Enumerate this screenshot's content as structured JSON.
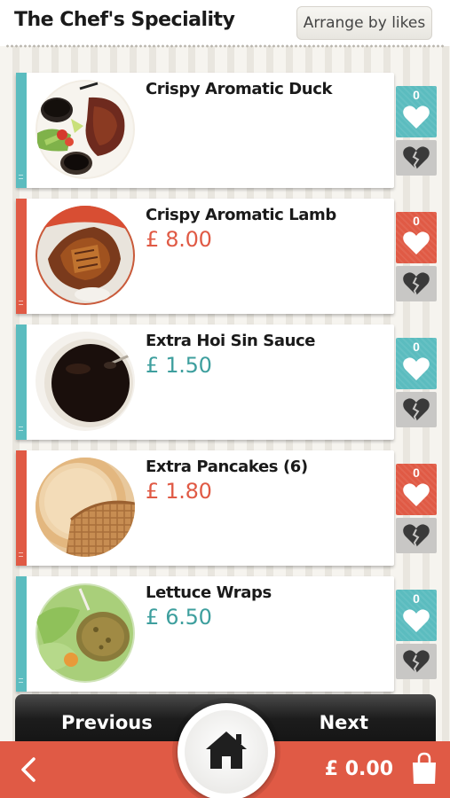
{
  "header": {
    "title": "The Chef's Speciality",
    "sort_label": "Arrange by likes"
  },
  "colors": {
    "teal": "#5bbcbf",
    "red": "#e05a45",
    "teal_text": "#3e9f9e",
    "red_text": "#e05a45"
  },
  "items": [
    {
      "name": "Crispy Aromatic Duck",
      "price": "",
      "likes": "0",
      "accent": "teal",
      "image": "duck-dish-photo"
    },
    {
      "name": "Crispy Aromatic Lamb",
      "price": "£ 8.00",
      "likes": "0",
      "accent": "red",
      "image": "lamb-dish-photo"
    },
    {
      "name": "Extra Hoi Sin Sauce",
      "price": "£ 1.50",
      "likes": "0",
      "accent": "teal",
      "image": "hoisin-sauce-photo"
    },
    {
      "name": "Extra Pancakes (6)",
      "price": "£ 1.80",
      "likes": "0",
      "accent": "red",
      "image": "pancakes-steamer-photo"
    },
    {
      "name": "Lettuce Wraps",
      "price": "£ 6.50",
      "likes": "0",
      "accent": "teal",
      "image": "lettuce-wraps-photo"
    }
  ],
  "icons": {
    "like": "heart-icon",
    "dislike": "broken-heart-icon",
    "home": "home-icon",
    "back": "chevron-left-icon",
    "bag": "shopping-bag-icon"
  },
  "pager": {
    "previous": "Previous",
    "next": "Next"
  },
  "footer": {
    "total": "£ 0.00"
  }
}
